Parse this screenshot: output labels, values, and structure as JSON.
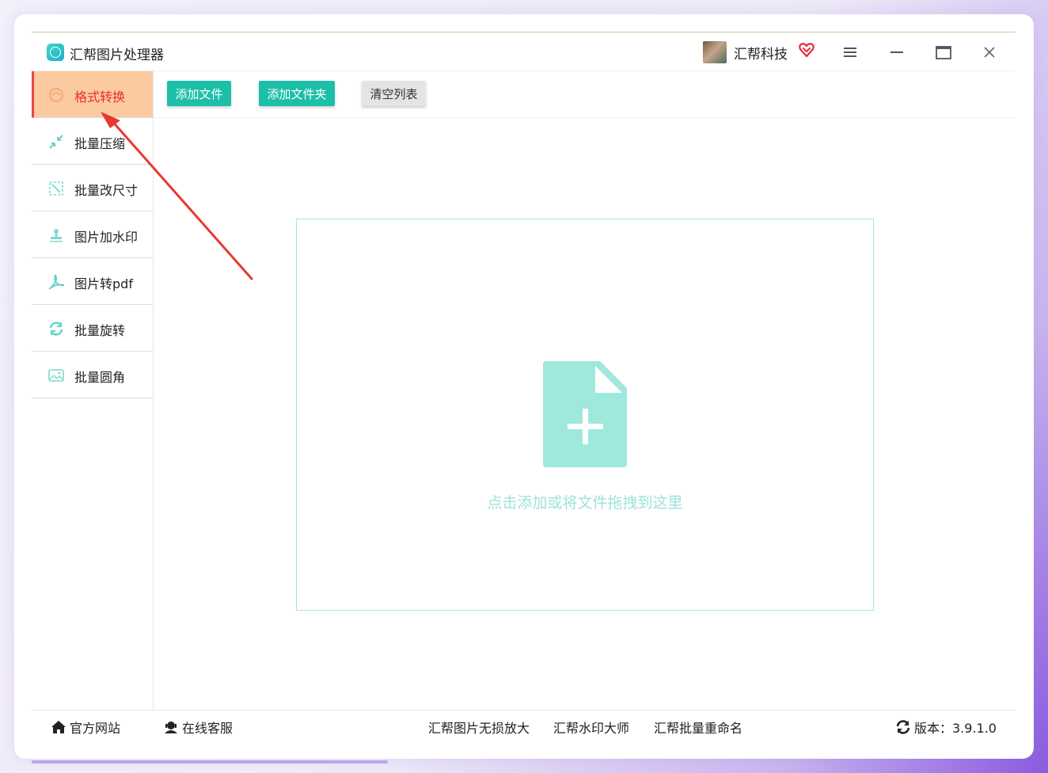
{
  "app": {
    "title": "汇帮图片处理器",
    "company": "汇帮科技"
  },
  "toolbar": {
    "add_file": "添加文件",
    "add_folder": "添加文件夹",
    "clear_list": "清空列表"
  },
  "sidebar": {
    "items": [
      {
        "label": "格式转换",
        "icon": "format-convert-icon",
        "active": true
      },
      {
        "label": "批量压缩",
        "icon": "compress-icon"
      },
      {
        "label": "批量改尺寸",
        "icon": "resize-icon"
      },
      {
        "label": "图片加水印",
        "icon": "watermark-icon"
      },
      {
        "label": "图片转pdf",
        "icon": "pdf-icon"
      },
      {
        "label": "批量旋转",
        "icon": "rotate-icon"
      },
      {
        "label": "批量圆角",
        "icon": "rounded-corner-icon"
      }
    ]
  },
  "dropzone": {
    "text": "点击添加或将文件拖拽到这里",
    "icon": "file-add-icon"
  },
  "footer": {
    "website": "官方网站",
    "support": "在线客服",
    "product1": "汇帮图片无损放大",
    "product2": "汇帮水印大师",
    "product3": "汇帮批量重命名",
    "version": "版本：3.9.1.0"
  },
  "colors": {
    "accent": "#1dbfa9",
    "active_bg": "#fccaa0",
    "active_text": "#e62e2e",
    "drop_border": "#a9e3dc"
  }
}
